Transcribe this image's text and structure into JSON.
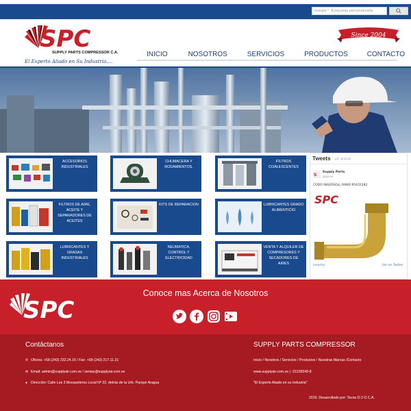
{
  "search": {
    "placeholder": "Google™ Búsqueda personalizada",
    "button_label": ""
  },
  "brand": {
    "logo_text": "SPC",
    "company_line": "SUPPLY PARTS COMPRESSOR C.A.",
    "tagline": "El Experto Aliado en Su Industria....",
    "since": "Since 2004"
  },
  "nav": {
    "items": [
      "INICIO",
      "NOSOTROS",
      "SERVICIOS",
      "PRODUCTOS",
      "CONTACTO"
    ]
  },
  "products": [
    {
      "label": "ACCESORIOS INDUSTRIALES",
      "icon": "fittings-icon"
    },
    {
      "label": "CHUMACERA Y RODAMIENTOS.",
      "icon": "bearing-icon"
    },
    {
      "label": "FILTROS COALESCENTES",
      "icon": "filter-housing-icon"
    },
    {
      "label": "FILTROS DE AIRE, ACEITE Y SEPARADORES DE ACEITES",
      "icon": "filters-icon"
    },
    {
      "label": "KITS DE REPARACION",
      "icon": "repair-kit-icon"
    },
    {
      "label": "LUBRICANTES GRADO ALIMENTICIO",
      "icon": "drops-icon"
    },
    {
      "label": "LUBRICANTES Y GRASAS INDUSTRIALES",
      "icon": "lubricant-cans-icon"
    },
    {
      "label": "NEUMATICA, CONTROL Y ELECTRICIDAD",
      "icon": "pneumatic-icon"
    },
    {
      "label": "VENTA Y ALQUILER DE COMPRESORES Y SECADORES DE AIRES",
      "icon": "compressor-icon"
    }
  ],
  "tweets": {
    "title": "Tweets",
    "by": "por @spcsa",
    "user": "Supply Parts",
    "handle": "@spcsa",
    "text": "CODO INGERSOLL RAND 95431282",
    "embed": "Insertar",
    "view": "Ver en Twitter"
  },
  "banner": {
    "title": "Conoce mas Acerca de Nosotros"
  },
  "footer": {
    "contact_title": "Contáctanos",
    "phone": "Oficina: +58 (243) 232.24.16 / Fax: +58 (243) 217.11.21",
    "email": "Email: admin@supplyair.com.ve / ventas@supplyair.com.ve",
    "address": "Dirección: Calle Los 3 Mosqueteros Local Nº 22, detrás de la Urb. Parque Aragua",
    "company_title": "SUPPLY PARTS COMPRESSOR",
    "links": "Inicio / Nosotros / Servicios / Productos / Nuestras Marcas /Contacto",
    "site": "www.supplyair.com.ve | -31236549-8",
    "quote": "\"El Experto Aliado en su Industria\"",
    "credit": "2016. Desarrollado por: Tecno D 2 O C.A."
  },
  "colors": {
    "brand_blue": "#1a4a8e",
    "brand_red": "#c8202a",
    "footer_red": "#a61b21"
  }
}
